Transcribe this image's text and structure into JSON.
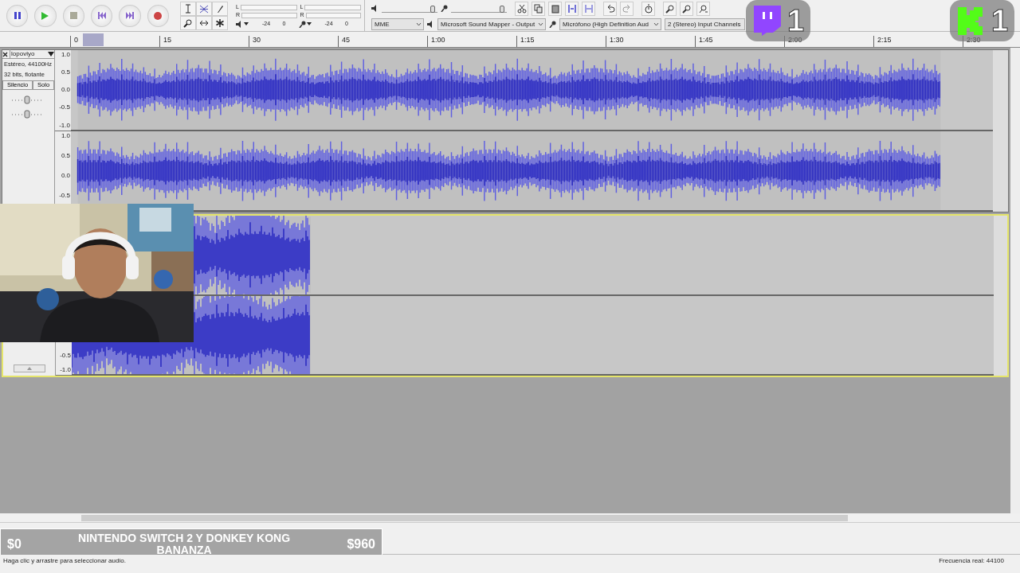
{
  "meters": {
    "play": {
      "channels": [
        "L",
        "R"
      ],
      "scale": [
        "-24",
        "0"
      ]
    },
    "record": {
      "channels": [
        "L",
        "R"
      ],
      "scale": [
        "-24",
        "0"
      ]
    }
  },
  "mixer": {
    "output": {
      "level": 0.95
    },
    "input": {
      "level": 0.95
    }
  },
  "devices": {
    "host": "MME",
    "output": "Microsoft Sound Mapper - Output",
    "input": "Micrófono (High Definition Aud",
    "channels": "2 (Stereo) Input Channels"
  },
  "ruler": [
    "0",
    "15",
    "30",
    "45",
    "1:00",
    "1:15",
    "1:30",
    "1:45",
    "2:00",
    "2:15",
    "2:30"
  ],
  "tracks": [
    {
      "name": "lopoviyo",
      "info": [
        "Estéreo, 44100Hz",
        "32 bits, flotante"
      ],
      "buttons": [
        "Silencio",
        "Solo"
      ],
      "selected": false,
      "kind": "full",
      "channels": [
        {
          "scale": [
            "1.0",
            "0.5",
            "0.0",
            "-0.5",
            "-1.0"
          ]
        },
        {
          "scale": [
            "1.0",
            "0.5",
            "0.0",
            "-0.5"
          ]
        }
      ]
    },
    {
      "selected": true,
      "kind": "short",
      "channels": [
        {
          "scale": [
            "-0.5",
            "-1.0"
          ]
        }
      ]
    }
  ],
  "overlays": {
    "twitch_count": "1",
    "kick_count": "1",
    "goal": {
      "start": "$0",
      "title": "NINTENDO SWITCH 2 Y DONKEY KONG BANANZA",
      "target": "$960"
    }
  },
  "status_bar": {
    "hint": "Haga clic y arrastre para seleccionar audio.",
    "rate": "Frecuencia real: 44100"
  }
}
